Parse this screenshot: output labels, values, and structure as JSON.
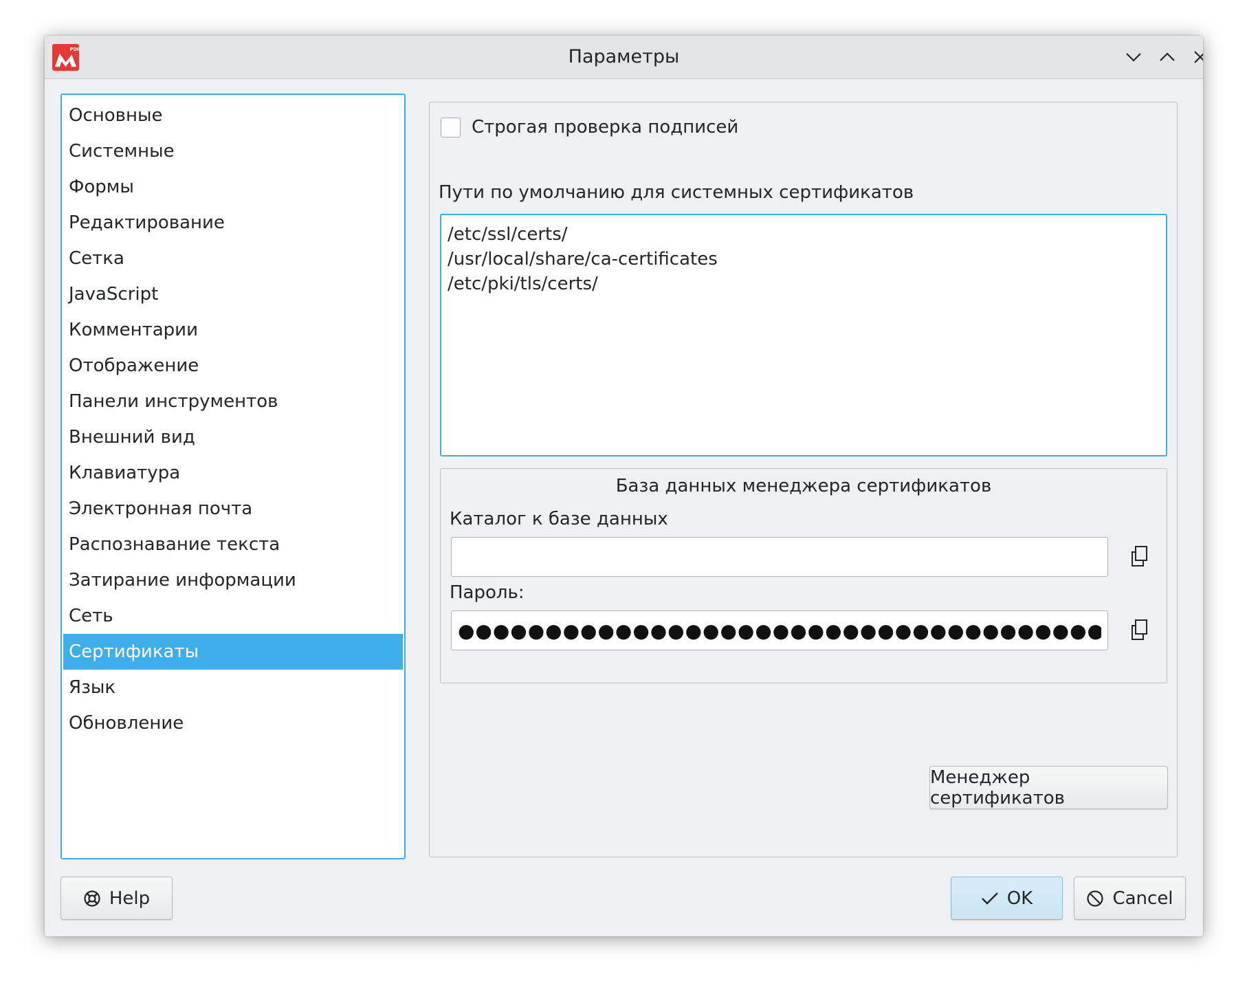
{
  "window": {
    "title": "Параметры",
    "app_icon": "pdf-app-icon",
    "controls": [
      "minimize-icon",
      "maximize-icon",
      "close-icon"
    ]
  },
  "sidebar": {
    "selected_index": 15,
    "items": [
      {
        "label": "Основные"
      },
      {
        "label": "Системные"
      },
      {
        "label": "Формы"
      },
      {
        "label": "Редактирование"
      },
      {
        "label": "Сетка"
      },
      {
        "label": "JavaScript"
      },
      {
        "label": "Комментарии"
      },
      {
        "label": "Отображение"
      },
      {
        "label": "Панели инструментов"
      },
      {
        "label": "Внешний вид"
      },
      {
        "label": "Клавиатура"
      },
      {
        "label": "Электронная почта"
      },
      {
        "label": "Распознавание текста"
      },
      {
        "label": "Затирание информации"
      },
      {
        "label": "Сеть"
      },
      {
        "label": "Сертификаты"
      },
      {
        "label": "Язык"
      },
      {
        "label": "Обновление"
      }
    ]
  },
  "certificates": {
    "strict_check_label": "Строгая проверка подписей",
    "strict_check_checked": false,
    "default_paths_label": "Пути по умолчанию для системных сертификатов",
    "default_paths": [
      "/etc/ssl/certs/",
      "/usr/local/share/ca-certificates",
      "/etc/pki/tls/certs/"
    ],
    "db_group_title": "База данных менеджера сертификатов",
    "db_dir_label": "Каталог к базе данных",
    "db_dir_value": "",
    "password_label": "Пароль:",
    "password_mask": "●●●●●●●●●●●●●●●●●●●●●●●●●●●●●●●●●●●●●",
    "cert_manager_button": "Менеджер сертификатов"
  },
  "footer": {
    "help_label": "Help",
    "ok_label": "OK",
    "cancel_label": "Cancel"
  },
  "colors": {
    "accent": "#3daee9",
    "window_bg": "#eff0f1",
    "app_icon_red": "#e53935"
  }
}
